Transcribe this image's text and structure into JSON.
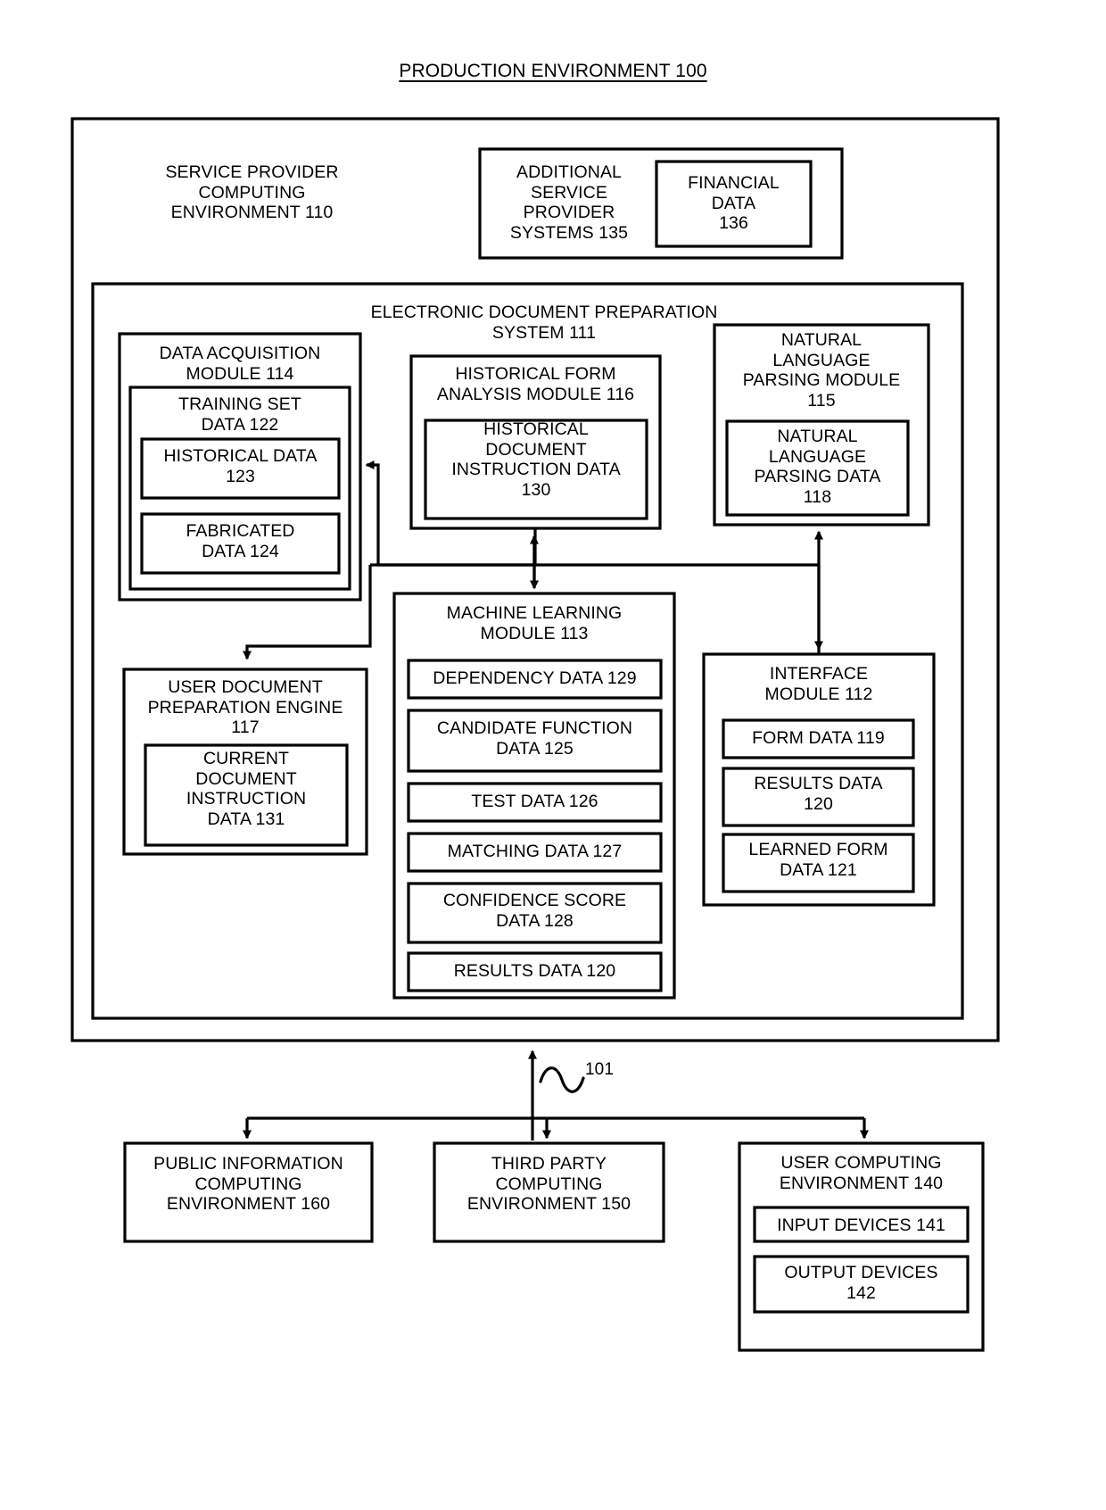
{
  "figure": {
    "title": "PRODUCTION ENVIRONMENT 100",
    "network_label": "101"
  },
  "boxes": {
    "service_provider_env": "SERVICE PROVIDER\nCOMPUTING\nENVIRONMENT 110",
    "additional_service_provider_systems": "ADDITIONAL\nSERVICE\nPROVIDER\nSYSTEMS 135",
    "financial_data": "FINANCIAL\nDATA\n136",
    "electronic_document_preparation_system": "ELECTRONIC DOCUMENT PREPARATION\nSYSTEM  111",
    "data_acquisition_module": "DATA ACQUISITION\nMODULE 114",
    "training_set_data": "TRAINING SET\nDATA 122",
    "historical_data": "HISTORICAL DATA\n123",
    "fabricated_data": "FABRICATED\nDATA 124",
    "historical_form_analysis_module": "HISTORICAL FORM\nANALYSIS MODULE 116",
    "historical_document_instruction_data": "HISTORICAL\nDOCUMENT\nINSTRUCTION DATA\n130",
    "natural_language_parsing_module": "NATURAL\nLANGUAGE\nPARSING MODULE\n115",
    "natural_language_parsing_data": "NATURAL\nLANGUAGE\nPARSING DATA\n118",
    "machine_learning_module": "MACHINE LEARNING\nMODULE 113",
    "dependency_data": "DEPENDENCY DATA 129",
    "candidate_function_data": "CANDIDATE FUNCTION\nDATA 125",
    "test_data": "TEST DATA 126",
    "matching_data": "MATCHING DATA 127",
    "confidence_score_data": "CONFIDENCE SCORE\nDATA 128",
    "results_data_ml": "RESULTS DATA 120",
    "user_document_preparation_engine": "USER DOCUMENT\nPREPARATION  ENGINE\n117",
    "current_document_instruction_data": "CURRENT\nDOCUMENT\nINSTRUCTION\nDATA 131",
    "interface_module": "INTERFACE\nMODULE 112",
    "form_data": "FORM DATA 119",
    "results_data_interface": "RESULTS DATA\n120",
    "learned_form_data": "LEARNED FORM\nDATA 121",
    "public_information_env": "PUBLIC INFORMATION\nCOMPUTING\nENVIRONMENT 160",
    "third_party_env": "THIRD PARTY\nCOMPUTING\nENVIRONMENT 150",
    "user_computing_env": "USER COMPUTING\nENVIRONMENT 140",
    "input_devices": "INPUT DEVICES 141",
    "output_devices": "OUTPUT DEVICES\n142"
  },
  "colors": {
    "stroke": "#000000",
    "background": "#ffffff"
  }
}
